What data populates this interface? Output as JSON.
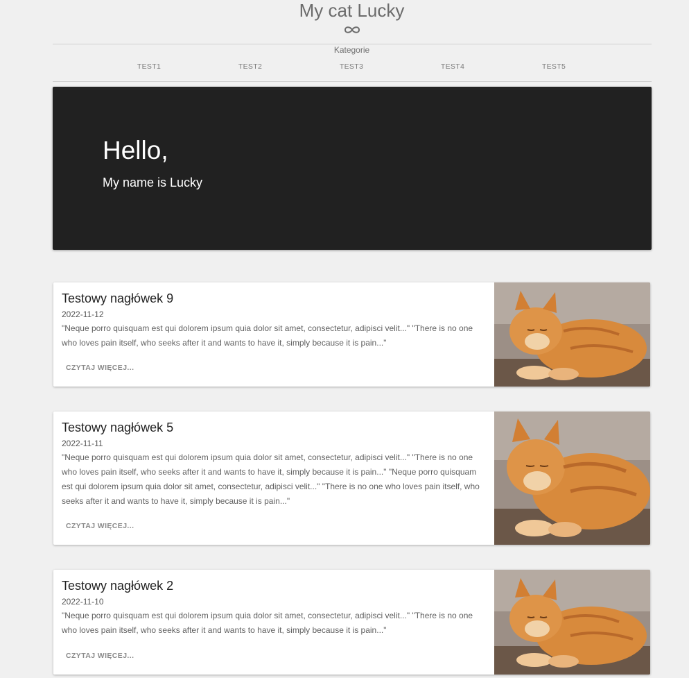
{
  "header": {
    "title": "My cat Lucky",
    "logo_icon": "infinity-icon",
    "categories_label": "Kategorie",
    "nav": [
      "TEST1",
      "TEST2",
      "TEST3",
      "TEST4",
      "TEST5"
    ]
  },
  "hero": {
    "title": "Hello,",
    "subtitle": "My name is Lucky"
  },
  "posts": [
    {
      "title": "Testowy nagłówek 9",
      "date": "2022-11-12",
      "excerpt": "\"Neque porro quisquam est qui dolorem ipsum quia dolor sit amet, consectetur, adipisci velit...\" \"There is no one who loves pain itself, who seeks after it and wants to have it, simply because it is pain...\"",
      "link": "CZYTAJ WIĘCEJ..."
    },
    {
      "title": "Testowy nagłówek 5",
      "date": "2022-11-11",
      "excerpt": "\"Neque porro quisquam est qui dolorem ipsum quia dolor sit amet, consectetur, adipisci velit...\" \"There is no one who loves pain itself, who seeks after it and wants to have it, simply because it is pain...\" \"Neque porro quisquam est qui dolorem ipsum quia dolor sit amet, consectetur, adipisci velit...\" \"There is no one who loves pain itself, who seeks after it and wants to have it, simply because it is pain...\"",
      "link": "CZYTAJ WIĘCEJ..."
    },
    {
      "title": "Testowy nagłówek 2",
      "date": "2022-11-10",
      "excerpt": "\"Neque porro quisquam est qui dolorem ipsum quia dolor sit amet, consectetur, adipisci velit...\" \"There is no one who loves pain itself, who seeks after it and wants to have it, simply because it is pain...\"",
      "link": "CZYTAJ WIĘCEJ..."
    }
  ],
  "colors": {
    "background": "#f0f0f0",
    "hero": "#212121",
    "card": "#ffffff"
  }
}
